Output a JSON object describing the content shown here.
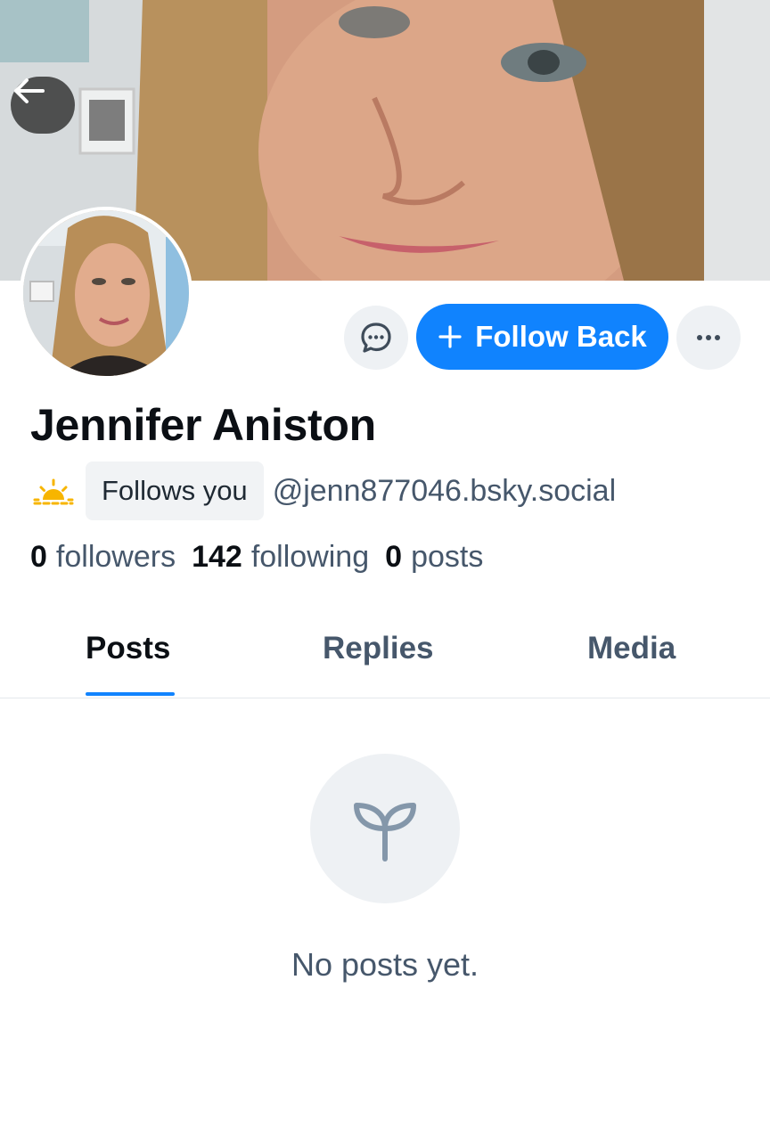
{
  "header": {
    "back_icon": "arrow-left-icon"
  },
  "profile": {
    "display_name": "Jennifer Aniston",
    "follows_you_label": "Follows you",
    "handle": "@jenn877046.bsky.social",
    "status_icon": "sunrise-icon"
  },
  "actions": {
    "message_icon": "chat-bubble-icon",
    "follow_back_label": "Follow Back",
    "follow_icon": "plus-icon",
    "more_icon": "ellipsis-icon"
  },
  "stats": {
    "followers_count": "0",
    "followers_label": "followers",
    "following_count": "142",
    "following_label": "following",
    "posts_count": "0",
    "posts_label": "posts"
  },
  "tabs": [
    {
      "label": "Posts",
      "active": true
    },
    {
      "label": "Replies",
      "active": false
    },
    {
      "label": "Media",
      "active": false
    }
  ],
  "feed": {
    "empty_icon": "sprout-icon",
    "empty_message": "No posts yet."
  },
  "colors": {
    "accent": "#1083fe",
    "text_primary": "#0b0f14",
    "text_secondary": "#46576b",
    "chip_bg": "#eef1f4"
  }
}
